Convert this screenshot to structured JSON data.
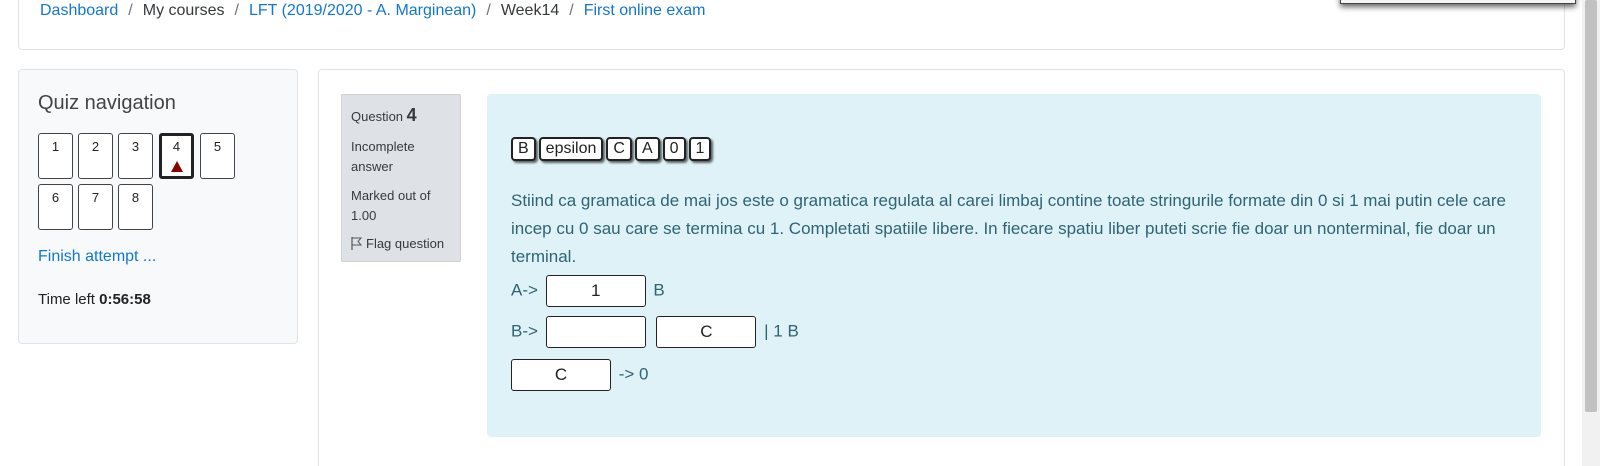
{
  "breadcrumb": {
    "dashboard": "Dashboard",
    "my_courses": "My courses",
    "course": "LFT (2019/2020 - A. Marginean)",
    "week": "Week14",
    "quiz": "First online exam",
    "separator": "/"
  },
  "nav": {
    "title": "Quiz navigation",
    "questions": [
      "1",
      "2",
      "3",
      "4",
      "5",
      "6",
      "7",
      "8"
    ],
    "current_question": "4",
    "finish": "Finish attempt ...",
    "time_left_label": "Time left",
    "time_left_value": "0:56:58"
  },
  "question": {
    "label": "Question",
    "number": "4",
    "state": "Incomplete answer",
    "grade": "Marked out of 1.00",
    "flag_label": "Flag question",
    "tokens": [
      "B",
      "epsilon",
      "C",
      "A",
      "0",
      "1"
    ],
    "text": "Stiind ca gramatica de mai jos este o gramatica regulata al carei limbaj contine toate stringurile formate din 0 si 1 mai putin cele care incep cu 0 sau care se termina cu 1. Completati spatiile libere. In fiecare spatiu liber puteti scrie fie doar un nonterminal, fie doar un terminal.",
    "rule1": {
      "prefix": "A->",
      "slot1": "1",
      "suffix": "B"
    },
    "rule2": {
      "prefix": "B->",
      "slot1": "",
      "slot2": "C",
      "suffix": "| 1 B"
    },
    "rule3": {
      "slot1": "C",
      "suffix": "-> 0"
    }
  },
  "colors": {
    "link": "#1177d1",
    "question_bg": "#def2f8",
    "question_text": "#2f6473",
    "flag_marker": "#8b0000"
  }
}
